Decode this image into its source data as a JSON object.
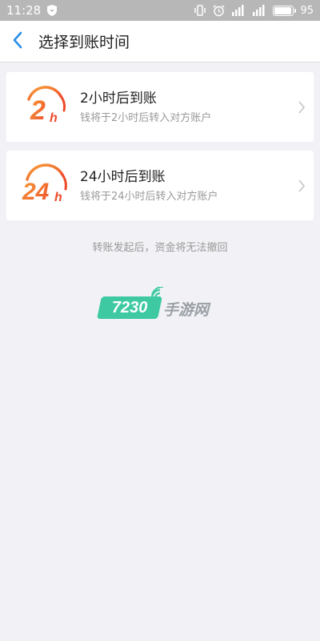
{
  "status_bar": {
    "time": "11:28",
    "battery": "95"
  },
  "nav": {
    "title": "选择到账时间"
  },
  "options": [
    {
      "icon_label": "2h",
      "title": "2小时后到账",
      "subtitle": "钱将于2小时后转入对方账户"
    },
    {
      "icon_label": "24h",
      "title": "24小时后到账",
      "subtitle": "钱将于24小时后转入对方账户"
    }
  ],
  "notice": "转账发起后，资金将无法撤回",
  "watermark": {
    "number": "7230",
    "text": "手游网"
  },
  "colors": {
    "accent_blue": "#2b8ee6",
    "icon_orange": "#f26b2b",
    "watermark_green": "#3ec9a2"
  }
}
